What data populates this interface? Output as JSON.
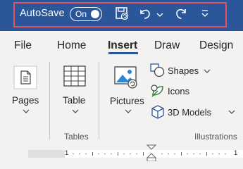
{
  "qat": {
    "autosave_label": "AutoSave",
    "toggle_state": "On"
  },
  "tabs": [
    {
      "label": "File"
    },
    {
      "label": "Home"
    },
    {
      "label": "Insert",
      "active": true
    },
    {
      "label": "Draw"
    },
    {
      "label": "Design"
    }
  ],
  "ribbon": {
    "pages_label": "Pages",
    "table_label": "Table",
    "tables_group": "Tables",
    "pictures_label": "Pictures",
    "shapes_label": "Shapes",
    "icons_label": "Icons",
    "models_label": "3D Models",
    "illustrations_group": "Illustrations"
  },
  "ruler": {
    "left_number": "1",
    "right_number": "1"
  },
  "colors": {
    "title_bar": "#2b579a",
    "highlight_box": "#e8505b",
    "ribbon_bg": "#f3f2f1",
    "accent_blue": "#2b579a"
  }
}
